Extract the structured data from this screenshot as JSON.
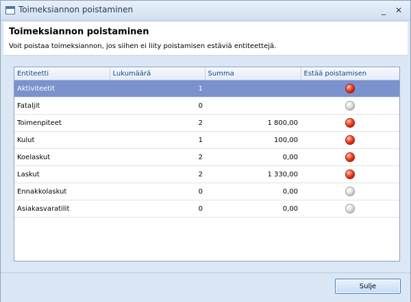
{
  "window": {
    "title": "Toimeksiannon poistaminen"
  },
  "header": {
    "title": "Toimeksiannon poistaminen",
    "description": "Voit poistaa toimeksiannon, jos siihen ei liity poistamisen estäviä entiteettejä."
  },
  "grid": {
    "columns": [
      "Entiteetti",
      "Lukumäärä",
      "Summa",
      "Estää poistamisen"
    ],
    "rows": [
      {
        "entity": "Aktiviteetit",
        "count": "1",
        "sum": "",
        "blocks": true,
        "selected": true
      },
      {
        "entity": "Fataljit",
        "count": "0",
        "sum": "",
        "blocks": false
      },
      {
        "entity": "Toimenpiteet",
        "count": "2",
        "sum": "1 800,00",
        "blocks": true
      },
      {
        "entity": "Kulut",
        "count": "1",
        "sum": "100,00",
        "blocks": true
      },
      {
        "entity": "Koelaskut",
        "count": "2",
        "sum": "0,00",
        "blocks": true
      },
      {
        "entity": "Laskut",
        "count": "2",
        "sum": "1 330,00",
        "blocks": true
      },
      {
        "entity": "Ennakkolaskut",
        "count": "0",
        "sum": "0,00",
        "blocks": false
      },
      {
        "entity": "Asiakasvaratilit",
        "count": "0",
        "sum": "0,00",
        "blocks": false
      }
    ]
  },
  "footer": {
    "close_label": "Sulje"
  },
  "colors": {
    "selection": "#7b92cf",
    "blocking": "#e0301a",
    "non_blocking": "#c0c0c0"
  },
  "icons": {
    "window": "window-icon",
    "minimize": "minimize-icon",
    "close": "close-icon"
  }
}
